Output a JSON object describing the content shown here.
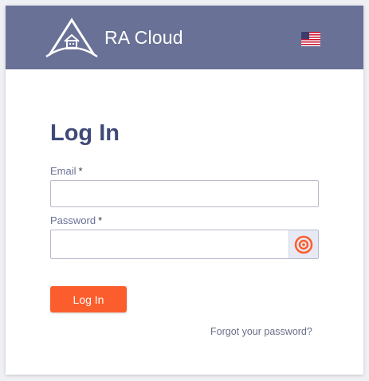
{
  "header": {
    "brand": "RA Cloud",
    "logo_icon": "house-mountain-logo-icon",
    "language_icon": "us-flag-icon"
  },
  "form": {
    "title": "Log In",
    "email_label": "Email",
    "email_value": "",
    "password_label": "Password",
    "password_value": "",
    "required_marker": "*",
    "show_password_icon": "eye-icon",
    "submit_label": "Log In",
    "forgot_link": "Forgot your password?"
  },
  "colors": {
    "header_bg": "#6a7196",
    "title": "#3f4a78",
    "accent": "#fb5e2c"
  }
}
